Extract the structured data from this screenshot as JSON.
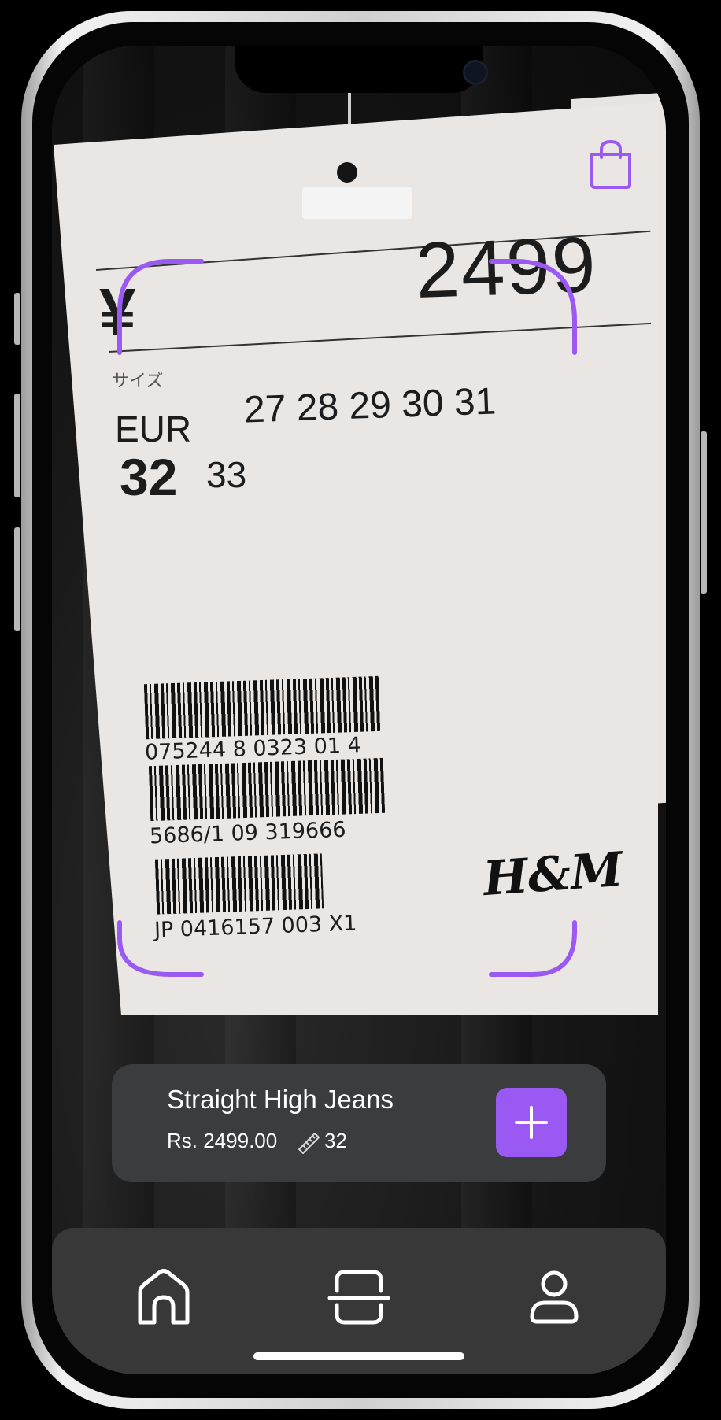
{
  "tag": {
    "currency_symbol": "¥",
    "price": "2499",
    "size_label_jp": "サイズ",
    "size_system": "EUR",
    "sizes": "27 28 29 30 31",
    "selected_size": "32",
    "next_size": "33",
    "barcode_1": "075244 8 0323 01 4",
    "barcode_2": "5686/1 09 319666",
    "barcode_3": "JP 0416157 003  X1",
    "brand": "H&M"
  },
  "product": {
    "name": "Straight High Jeans",
    "price": "Rs. 2499.00",
    "size": "32"
  },
  "nav": {
    "items": [
      {
        "icon": "home-icon"
      },
      {
        "icon": "scan-icon"
      },
      {
        "icon": "profile-icon"
      }
    ]
  },
  "colors": {
    "accent": "#9b59f4",
    "card_bg": "#3b3c3e",
    "nav_bg": "#383838"
  },
  "background_tag_text": "X1"
}
